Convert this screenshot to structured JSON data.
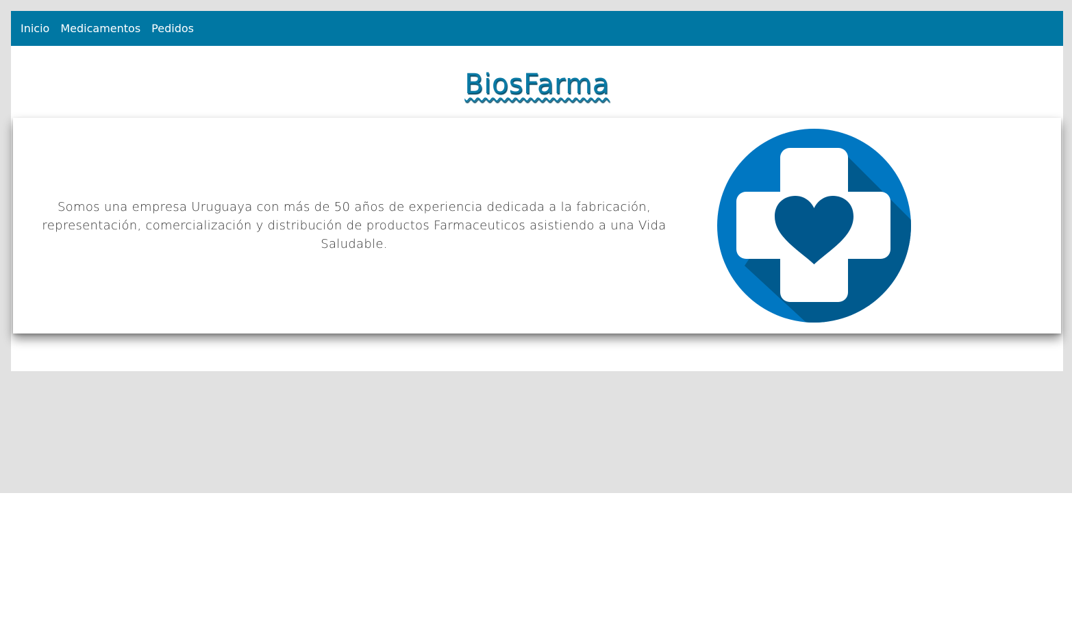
{
  "nav": {
    "items": [
      {
        "label": "Inicio"
      },
      {
        "label": "Medicamentos"
      },
      {
        "label": "Pedidos"
      }
    ]
  },
  "header": {
    "title": "BiosFarma"
  },
  "card": {
    "description": "Somos una empresa Uruguaya con más de 50 años de experiencia dedicada a la fabricación, representación, comercialización y distribución de productos Farmaceuticos asistiendo a una Vida Saludable.",
    "logo_icon": "medical-cross-heart-icon"
  },
  "colors": {
    "navbar": "#0077a3",
    "title": "#0a7aa5",
    "logo_circle": "#0077c2",
    "logo_shadow": "#005a8e",
    "heart": "#00578c",
    "backdrop": "#e1e1e1"
  }
}
